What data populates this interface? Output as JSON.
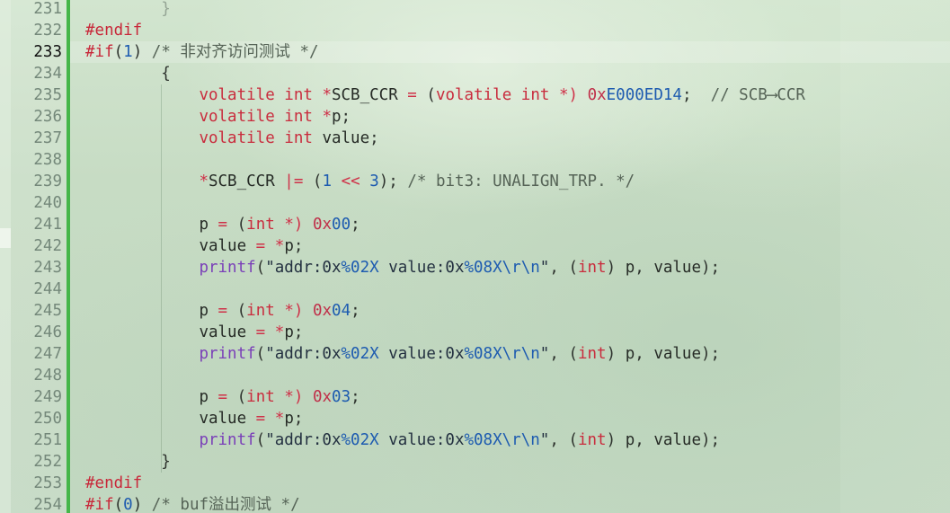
{
  "editor": {
    "current_line": 233
  },
  "colors": {
    "change_bar": "#45b649",
    "line_number": "#74887a",
    "line_number_current": "#111111"
  },
  "syntax_colors": {
    "preprocessor": "#c8283a",
    "keyword": "#c92c3d",
    "operator": "#cf3148",
    "number": "#1d5bb0",
    "hex-prefix": "#c0304a",
    "identifier": "#262b26",
    "punctuation": "#2d322d",
    "comment": "#566457",
    "function-name": "#7a3fb8",
    "string": "#233040",
    "format-specifier": "#1d5bb0",
    "faded-brace": "#95a595"
  },
  "lines": [
    {
      "num": 231,
      "tokens": [
        [
          "sp",
          "        "
        ],
        [
          "fade",
          "}"
        ]
      ]
    },
    {
      "num": 232,
      "tokens": [
        [
          "pp",
          "#endif"
        ]
      ]
    },
    {
      "num": 233,
      "tokens": [
        [
          "pp",
          "#if"
        ],
        [
          "pn",
          "("
        ],
        [
          "num",
          "1"
        ],
        [
          "pn",
          ")"
        ],
        [
          "sp",
          " "
        ],
        [
          "cm",
          "/* 非对齐访问测试 */"
        ]
      ]
    },
    {
      "num": 234,
      "tokens": [
        [
          "sp",
          "        "
        ],
        [
          "pn",
          "{"
        ]
      ]
    },
    {
      "num": 235,
      "tokens": [
        [
          "sp",
          "            "
        ],
        [
          "kw",
          "volatile"
        ],
        [
          "sp",
          " "
        ],
        [
          "kw",
          "int"
        ],
        [
          "sp",
          " "
        ],
        [
          "op",
          "*"
        ],
        [
          "id",
          "SCB_CCR"
        ],
        [
          "sp",
          " "
        ],
        [
          "op",
          "="
        ],
        [
          "sp",
          " "
        ],
        [
          "pn",
          "("
        ],
        [
          "kw",
          "volatile"
        ],
        [
          "sp",
          " "
        ],
        [
          "kw",
          "int"
        ],
        [
          "sp",
          " "
        ],
        [
          "op",
          "*)"
        ],
        [
          "sp",
          " "
        ],
        [
          "hex",
          "0x"
        ],
        [
          "num",
          "E000ED14"
        ],
        [
          "pn",
          ";"
        ],
        [
          "sp",
          "  "
        ],
        [
          "cm",
          "// SCB⟶CCR"
        ]
      ]
    },
    {
      "num": 236,
      "tokens": [
        [
          "sp",
          "            "
        ],
        [
          "kw",
          "volatile"
        ],
        [
          "sp",
          " "
        ],
        [
          "kw",
          "int"
        ],
        [
          "sp",
          " "
        ],
        [
          "op",
          "*"
        ],
        [
          "id",
          "p"
        ],
        [
          "pn",
          ";"
        ]
      ]
    },
    {
      "num": 237,
      "tokens": [
        [
          "sp",
          "            "
        ],
        [
          "kw",
          "volatile"
        ],
        [
          "sp",
          " "
        ],
        [
          "kw",
          "int"
        ],
        [
          "sp",
          " "
        ],
        [
          "id",
          "value"
        ],
        [
          "pn",
          ";"
        ]
      ]
    },
    {
      "num": 238,
      "tokens": []
    },
    {
      "num": 239,
      "tokens": [
        [
          "sp",
          "            "
        ],
        [
          "op",
          "*"
        ],
        [
          "id",
          "SCB_CCR"
        ],
        [
          "sp",
          " "
        ],
        [
          "op",
          "|="
        ],
        [
          "sp",
          " "
        ],
        [
          "pn",
          "("
        ],
        [
          "num",
          "1"
        ],
        [
          "sp",
          " "
        ],
        [
          "op",
          "<<"
        ],
        [
          "sp",
          " "
        ],
        [
          "num",
          "3"
        ],
        [
          "pn",
          ");"
        ],
        [
          "sp",
          " "
        ],
        [
          "cm",
          "/* bit3: UNALIGN_TRP. */"
        ]
      ]
    },
    {
      "num": 240,
      "tokens": []
    },
    {
      "num": 241,
      "tokens": [
        [
          "sp",
          "            "
        ],
        [
          "id",
          "p"
        ],
        [
          "sp",
          " "
        ],
        [
          "op",
          "="
        ],
        [
          "sp",
          " "
        ],
        [
          "pn",
          "("
        ],
        [
          "kw",
          "int"
        ],
        [
          "sp",
          " "
        ],
        [
          "op",
          "*)"
        ],
        [
          "sp",
          " "
        ],
        [
          "hex",
          "0x"
        ],
        [
          "num",
          "00"
        ],
        [
          "pn",
          ";"
        ]
      ]
    },
    {
      "num": 242,
      "tokens": [
        [
          "sp",
          "            "
        ],
        [
          "id",
          "value"
        ],
        [
          "sp",
          " "
        ],
        [
          "op",
          "="
        ],
        [
          "sp",
          " "
        ],
        [
          "op",
          "*"
        ],
        [
          "id",
          "p"
        ],
        [
          "pn",
          ";"
        ]
      ]
    },
    {
      "num": 243,
      "tokens": [
        [
          "sp",
          "            "
        ],
        [
          "fn",
          "printf"
        ],
        [
          "pn",
          "("
        ],
        [
          "str",
          "\"addr:0x"
        ],
        [
          "esc",
          "%02X"
        ],
        [
          "str",
          " value:0x"
        ],
        [
          "esc",
          "%08X"
        ],
        [
          "esc",
          "\\r\\n"
        ],
        [
          "str",
          "\""
        ],
        [
          "pn",
          ","
        ],
        [
          "sp",
          " "
        ],
        [
          "pn",
          "("
        ],
        [
          "kw",
          "int"
        ],
        [
          "pn",
          ")"
        ],
        [
          "sp",
          " "
        ],
        [
          "id",
          "p"
        ],
        [
          "pn",
          ","
        ],
        [
          "sp",
          " "
        ],
        [
          "id",
          "value"
        ],
        [
          "pn",
          ");"
        ]
      ]
    },
    {
      "num": 244,
      "tokens": []
    },
    {
      "num": 245,
      "tokens": [
        [
          "sp",
          "            "
        ],
        [
          "id",
          "p"
        ],
        [
          "sp",
          " "
        ],
        [
          "op",
          "="
        ],
        [
          "sp",
          " "
        ],
        [
          "pn",
          "("
        ],
        [
          "kw",
          "int"
        ],
        [
          "sp",
          " "
        ],
        [
          "op",
          "*)"
        ],
        [
          "sp",
          " "
        ],
        [
          "hex",
          "0x"
        ],
        [
          "num",
          "04"
        ],
        [
          "pn",
          ";"
        ]
      ]
    },
    {
      "num": 246,
      "tokens": [
        [
          "sp",
          "            "
        ],
        [
          "id",
          "value"
        ],
        [
          "sp",
          " "
        ],
        [
          "op",
          "="
        ],
        [
          "sp",
          " "
        ],
        [
          "op",
          "*"
        ],
        [
          "id",
          "p"
        ],
        [
          "pn",
          ";"
        ]
      ]
    },
    {
      "num": 247,
      "tokens": [
        [
          "sp",
          "            "
        ],
        [
          "fn",
          "printf"
        ],
        [
          "pn",
          "("
        ],
        [
          "str",
          "\"addr:0x"
        ],
        [
          "esc",
          "%02X"
        ],
        [
          "str",
          " value:0x"
        ],
        [
          "esc",
          "%08X"
        ],
        [
          "esc",
          "\\r\\n"
        ],
        [
          "str",
          "\""
        ],
        [
          "pn",
          ","
        ],
        [
          "sp",
          " "
        ],
        [
          "pn",
          "("
        ],
        [
          "kw",
          "int"
        ],
        [
          "pn",
          ")"
        ],
        [
          "sp",
          " "
        ],
        [
          "id",
          "p"
        ],
        [
          "pn",
          ","
        ],
        [
          "sp",
          " "
        ],
        [
          "id",
          "value"
        ],
        [
          "pn",
          ");"
        ]
      ]
    },
    {
      "num": 248,
      "tokens": []
    },
    {
      "num": 249,
      "tokens": [
        [
          "sp",
          "            "
        ],
        [
          "id",
          "p"
        ],
        [
          "sp",
          " "
        ],
        [
          "op",
          "="
        ],
        [
          "sp",
          " "
        ],
        [
          "pn",
          "("
        ],
        [
          "kw",
          "int"
        ],
        [
          "sp",
          " "
        ],
        [
          "op",
          "*)"
        ],
        [
          "sp",
          " "
        ],
        [
          "hex",
          "0x"
        ],
        [
          "num",
          "03"
        ],
        [
          "pn",
          ";"
        ]
      ]
    },
    {
      "num": 250,
      "tokens": [
        [
          "sp",
          "            "
        ],
        [
          "id",
          "value"
        ],
        [
          "sp",
          " "
        ],
        [
          "op",
          "="
        ],
        [
          "sp",
          " "
        ],
        [
          "op",
          "*"
        ],
        [
          "id",
          "p"
        ],
        [
          "pn",
          ";"
        ]
      ]
    },
    {
      "num": 251,
      "tokens": [
        [
          "sp",
          "            "
        ],
        [
          "fn",
          "printf"
        ],
        [
          "pn",
          "("
        ],
        [
          "str",
          "\"addr:0x"
        ],
        [
          "esc",
          "%02X"
        ],
        [
          "str",
          " value:0x"
        ],
        [
          "esc",
          "%08X"
        ],
        [
          "esc",
          "\\r\\n"
        ],
        [
          "str",
          "\""
        ],
        [
          "pn",
          ","
        ],
        [
          "sp",
          " "
        ],
        [
          "pn",
          "("
        ],
        [
          "kw",
          "int"
        ],
        [
          "pn",
          ")"
        ],
        [
          "sp",
          " "
        ],
        [
          "id",
          "p"
        ],
        [
          "pn",
          ","
        ],
        [
          "sp",
          " "
        ],
        [
          "id",
          "value"
        ],
        [
          "pn",
          ");"
        ]
      ]
    },
    {
      "num": 252,
      "tokens": [
        [
          "sp",
          "        "
        ],
        [
          "pn",
          "}"
        ]
      ]
    },
    {
      "num": 253,
      "tokens": [
        [
          "pp",
          "#endif"
        ]
      ]
    },
    {
      "num": 254,
      "tokens": [
        [
          "pp",
          "#if"
        ],
        [
          "pn",
          "("
        ],
        [
          "num",
          "0"
        ],
        [
          "pn",
          ")"
        ],
        [
          "sp",
          " "
        ],
        [
          "cm",
          "/* buf溢出测试 */"
        ]
      ]
    }
  ]
}
